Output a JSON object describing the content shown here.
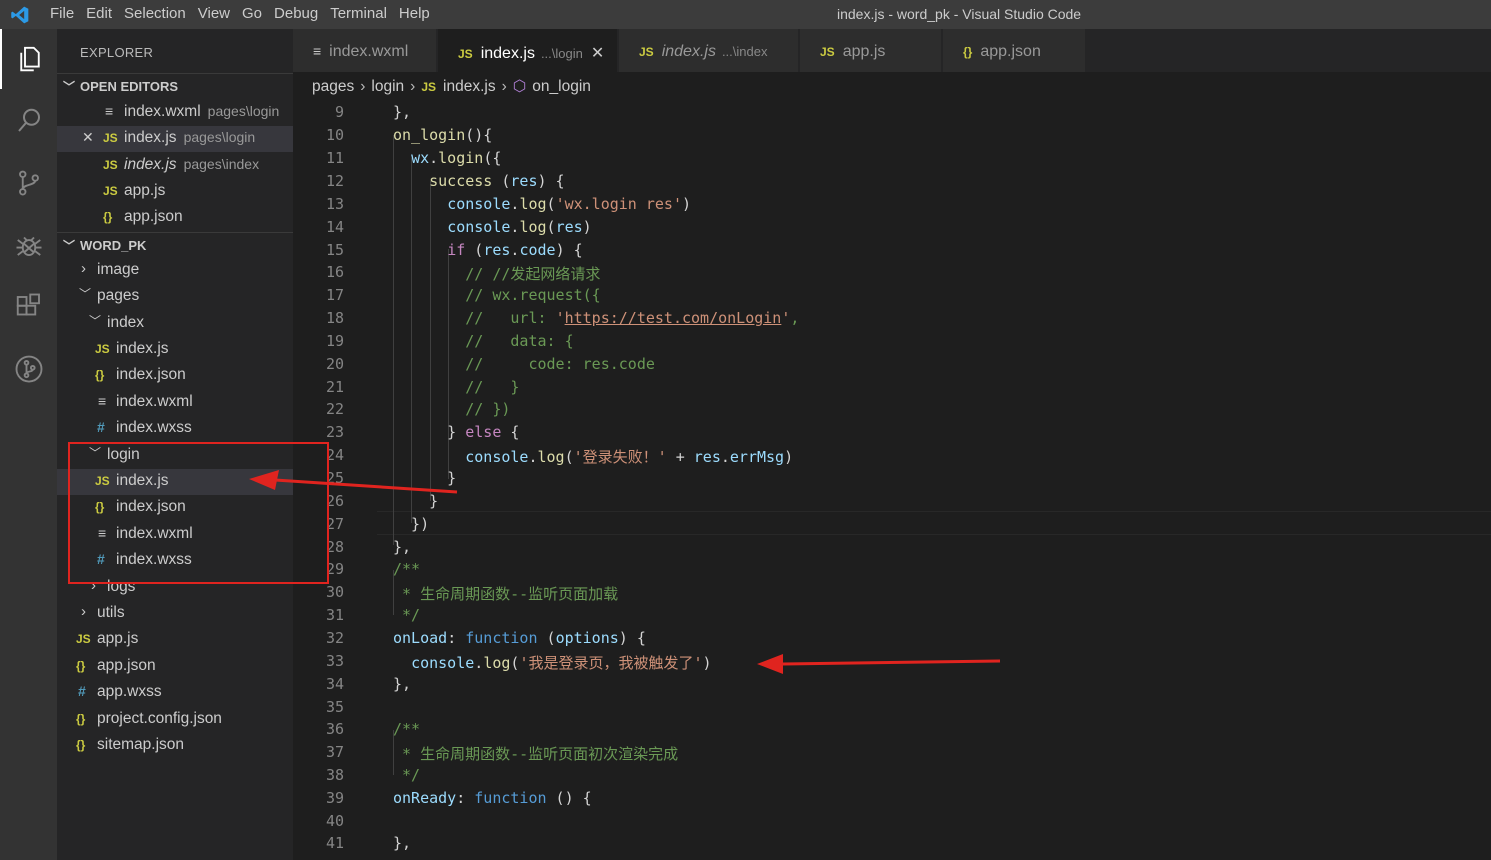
{
  "window": {
    "title": "index.js - word_pk - Visual Studio Code"
  },
  "menu": [
    "File",
    "Edit",
    "Selection",
    "View",
    "Go",
    "Debug",
    "Terminal",
    "Help"
  ],
  "activity": [
    "files-icon",
    "search-icon",
    "source-control-icon",
    "debug-icon",
    "extensions-icon",
    "git-graph-icon"
  ],
  "sidebar": {
    "title": "EXPLORER",
    "open_editors_label": "OPEN EDITORS",
    "open_editors": [
      {
        "name": "index.wxml",
        "path": "pages\\login",
        "type": "wxml"
      },
      {
        "name": "index.js",
        "path": "pages\\login",
        "type": "js",
        "close": "✕"
      },
      {
        "name": "index.js",
        "path": "pages\\index",
        "type": "js"
      },
      {
        "name": "app.js",
        "path": "",
        "type": "js"
      },
      {
        "name": "app.json",
        "path": "",
        "type": "json"
      }
    ],
    "project_label": "WORD_PK",
    "tree": [
      {
        "name": "image",
        "kind": "folder",
        "collapsed": true
      },
      {
        "name": "pages",
        "kind": "folder"
      },
      {
        "name": "index",
        "kind": "folder"
      },
      {
        "name": "index.js",
        "kind": "js"
      },
      {
        "name": "index.json",
        "kind": "json"
      },
      {
        "name": "index.wxml",
        "kind": "wxml"
      },
      {
        "name": "index.wxss",
        "kind": "wxss"
      },
      {
        "name": "login",
        "kind": "folder"
      },
      {
        "name": "index.js",
        "kind": "js"
      },
      {
        "name": "index.json",
        "kind": "json"
      },
      {
        "name": "index.wxml",
        "kind": "wxml"
      },
      {
        "name": "index.wxss",
        "kind": "wxss"
      },
      {
        "name": "logs",
        "kind": "folder",
        "collapsed": true
      },
      {
        "name": "utils",
        "kind": "folder",
        "collapsed": true
      },
      {
        "name": "app.js",
        "kind": "js"
      },
      {
        "name": "app.json",
        "kind": "json"
      },
      {
        "name": "app.wxss",
        "kind": "wxss"
      },
      {
        "name": "project.config.json",
        "kind": "json"
      },
      {
        "name": "sitemap.json",
        "kind": "json"
      }
    ]
  },
  "tabs": [
    {
      "name": "index.wxml",
      "sub": "",
      "type": "wxml"
    },
    {
      "name": "index.js",
      "sub": "...\\login",
      "type": "js",
      "active": true,
      "close": "✕"
    },
    {
      "name": "index.js",
      "sub": "...\\index",
      "type": "js"
    },
    {
      "name": "app.js",
      "sub": "",
      "type": "js"
    },
    {
      "name": "app.json",
      "sub": "",
      "type": "json"
    }
  ],
  "breadcrumb": [
    "pages",
    "login",
    "index.js",
    "on_login"
  ],
  "icons": {
    "js": "JS",
    "json": "{}",
    "wxml": "≡",
    "wxss": "#"
  },
  "line_numbers": [
    "9",
    "10",
    "11",
    "12",
    "13",
    "14",
    "15",
    "16",
    "17",
    "18",
    "19",
    "20",
    "21",
    "22",
    "23",
    "24",
    "25",
    "26",
    "27",
    "28",
    "29",
    "30",
    "31",
    "32",
    "33",
    "34",
    "35",
    "36",
    "37",
    "38",
    "39",
    "40",
    "41"
  ]
}
